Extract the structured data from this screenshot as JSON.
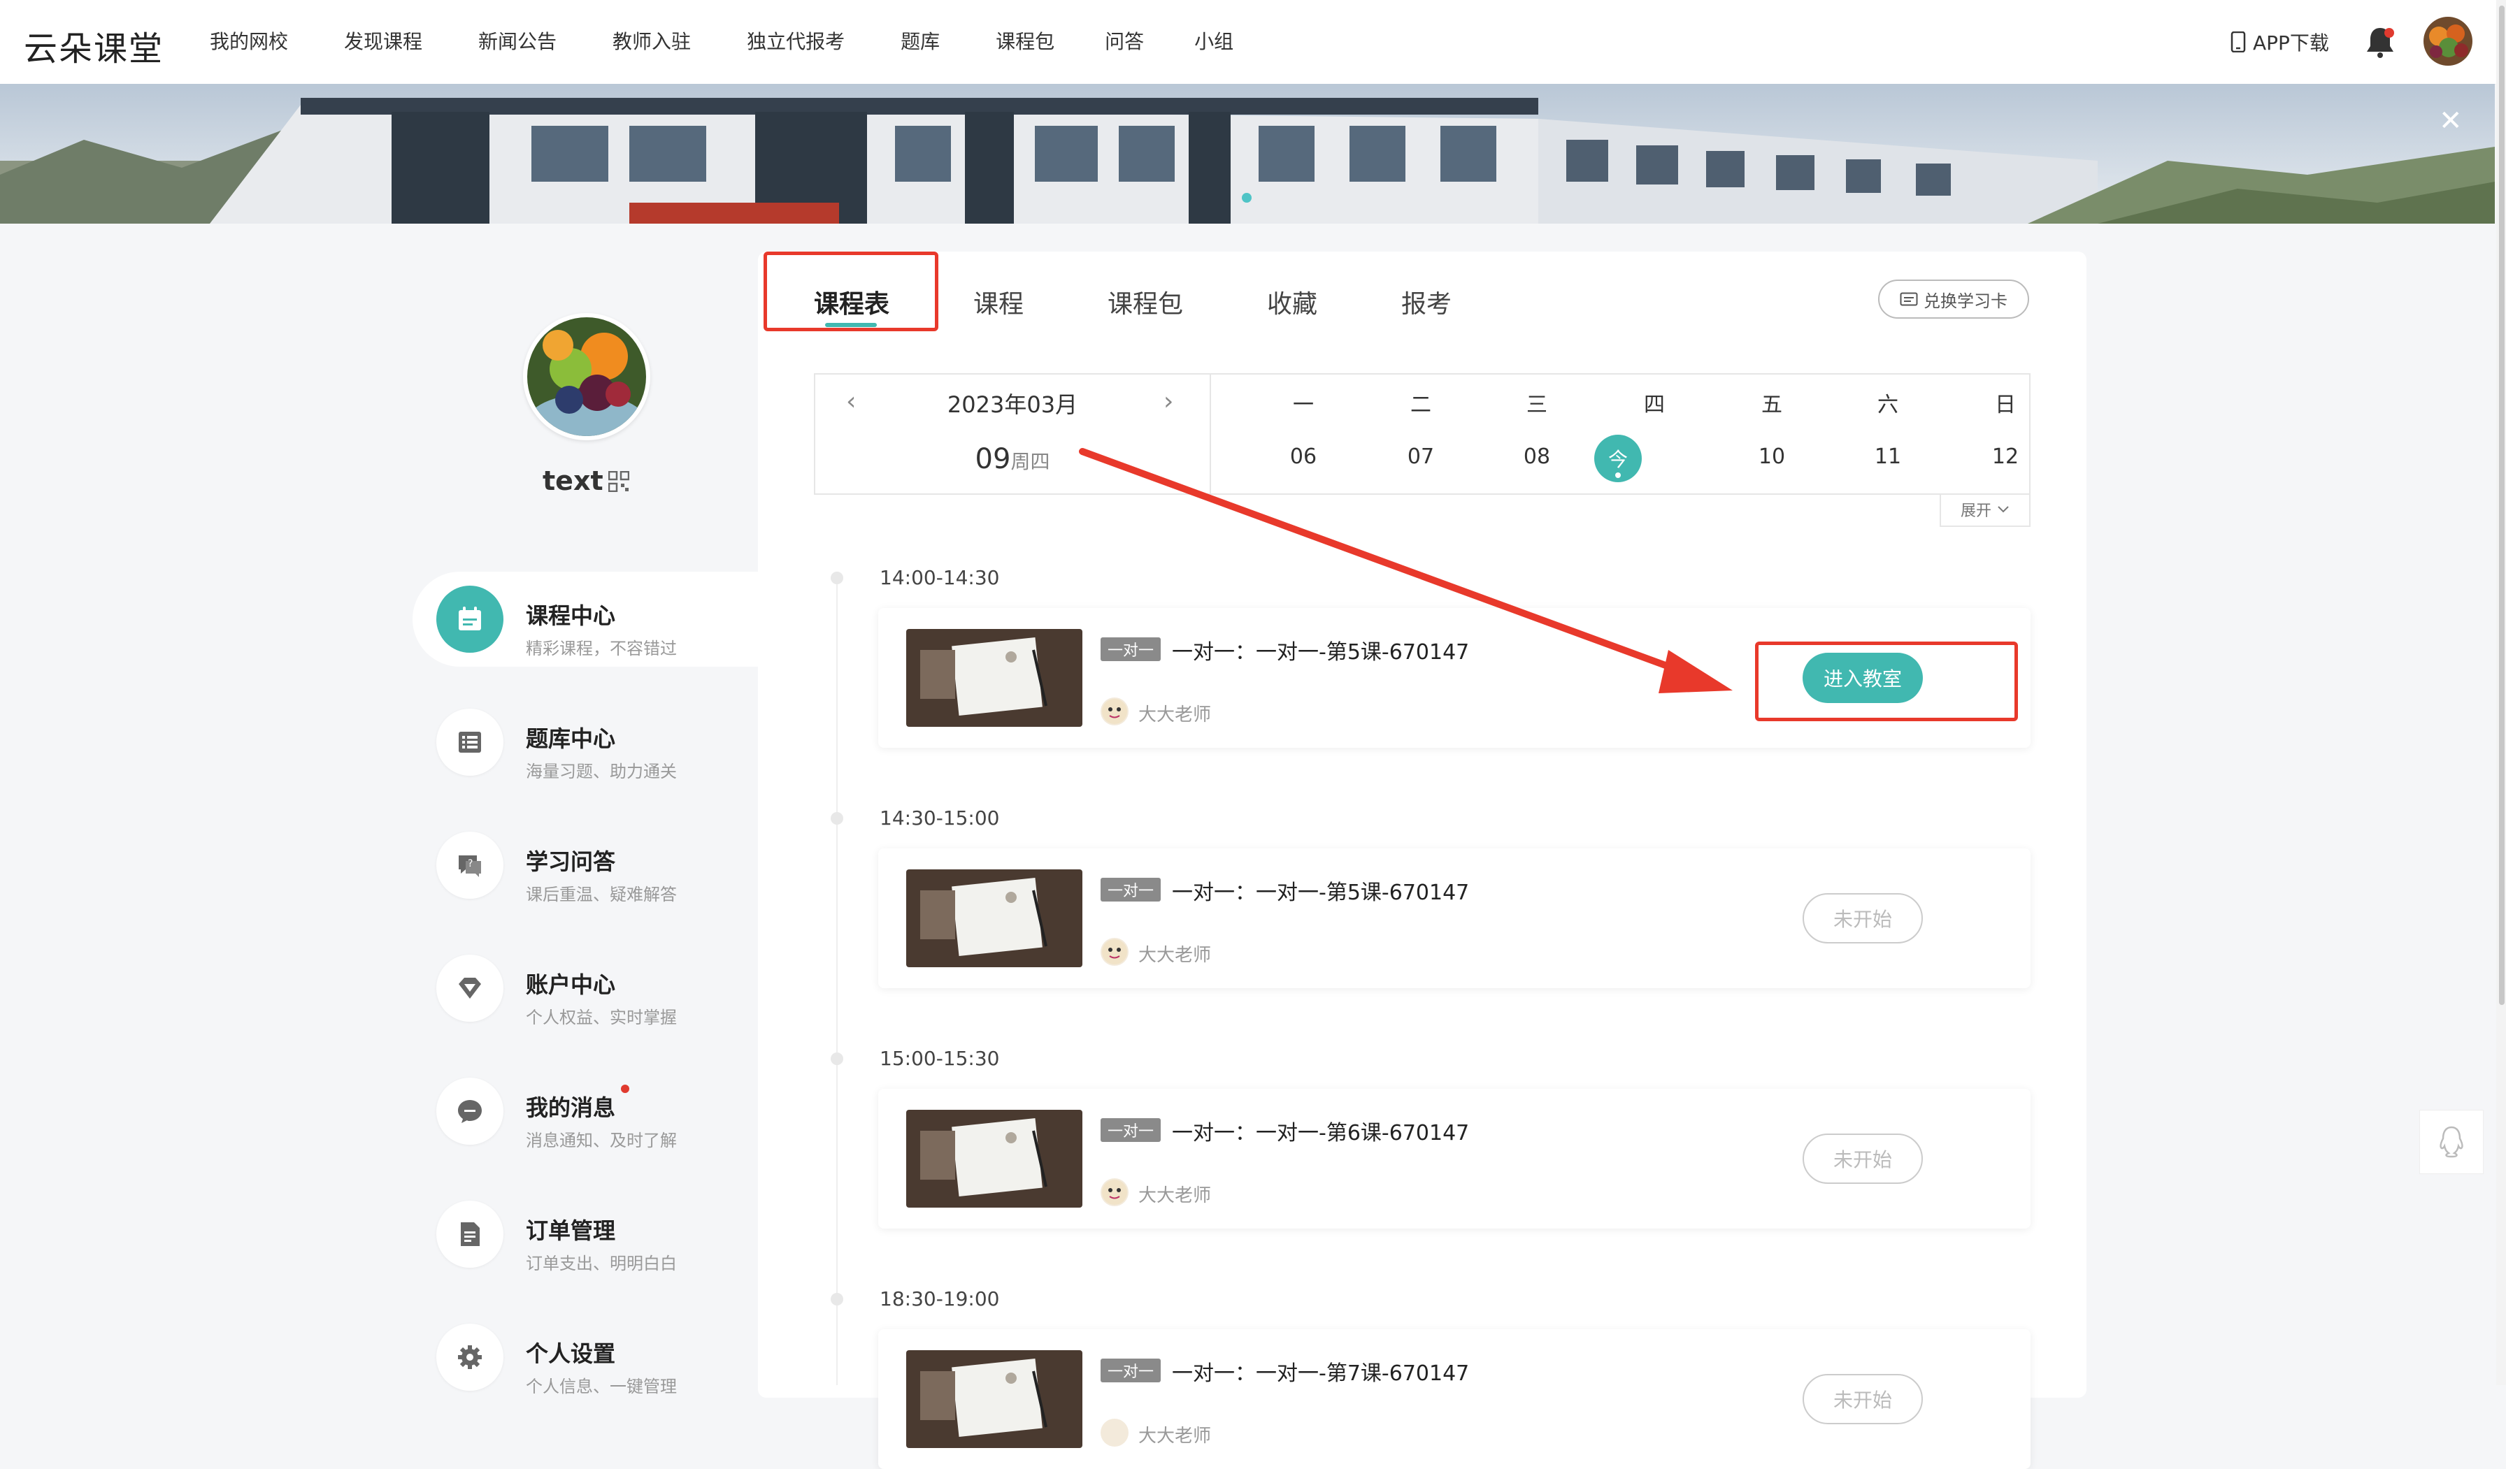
{
  "header": {
    "logo": "云朵课堂",
    "nav": [
      "我的网校",
      "发现课程",
      "新闻公告",
      "教师入驻",
      "独立代报考",
      "题库",
      "课程包",
      "问答",
      "小组"
    ],
    "app_download": "APP下载"
  },
  "profile": {
    "username": "text"
  },
  "sidebar": {
    "items": [
      {
        "title": "课程中心",
        "subtitle": "精彩课程，不容错过",
        "icon": "calendar-icon",
        "active": true
      },
      {
        "title": "题库中心",
        "subtitle": "海量习题、助力通关",
        "icon": "list-icon"
      },
      {
        "title": "学习问答",
        "subtitle": "课后重温、疑难解答",
        "icon": "chat-question-icon"
      },
      {
        "title": "账户中心",
        "subtitle": "个人权益、实时掌握",
        "icon": "diamond-icon"
      },
      {
        "title": "我的消息",
        "subtitle": "消息通知、及时了解",
        "icon": "message-icon",
        "unread": true
      },
      {
        "title": "订单管理",
        "subtitle": "订单支出、明明白白",
        "icon": "document-icon"
      },
      {
        "title": "个人设置",
        "subtitle": "个人信息、一键管理",
        "icon": "gear-icon"
      }
    ]
  },
  "tabs": [
    "课程表",
    "课程",
    "课程包",
    "收藏",
    "报考"
  ],
  "redeem_label": "兑换学习卡",
  "calendar": {
    "month": "2023年03月",
    "day": "09",
    "weekday": "周四",
    "weekdays": [
      "一",
      "二",
      "三",
      "四",
      "五",
      "六",
      "日"
    ],
    "dates": [
      "06",
      "07",
      "08",
      "今",
      "10",
      "11",
      "12"
    ],
    "expand_label": "展开"
  },
  "schedule": [
    {
      "time": "14:00-14:30",
      "tag": "一对一",
      "title": "一对一：一对一-第5课-670147",
      "teacher": "大大老师",
      "button": "进入教室",
      "state": "enter"
    },
    {
      "time": "14:30-15:00",
      "tag": "一对一",
      "title": "一对一：一对一-第5课-670147",
      "teacher": "大大老师",
      "button": "未开始",
      "state": "waiting"
    },
    {
      "time": "15:00-15:30",
      "tag": "一对一",
      "title": "一对一：一对一-第6课-670147",
      "teacher": "大大老师",
      "button": "未开始",
      "state": "waiting"
    },
    {
      "time": "18:30-19:00",
      "tag": "一对一",
      "title": "一对一：一对一-第7课-670147",
      "teacher": "大大老师",
      "button": "未开始",
      "state": "waiting"
    }
  ],
  "colors": {
    "accent": "#41b8b0",
    "annotation": "#e8392b",
    "badge": "#e03a2f"
  }
}
